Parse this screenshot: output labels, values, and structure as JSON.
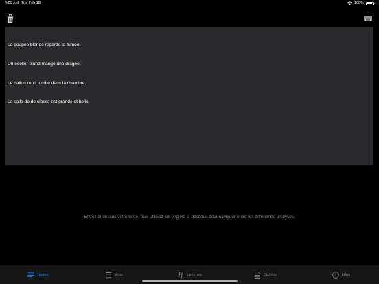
{
  "status_bar": {
    "time": "4:00 AM",
    "date": "Tue Feb 18",
    "battery": "100%"
  },
  "editor": {
    "lines": [
      "La poupée blonde regarde la fumée.",
      "Un écolier blond mange une dragée.",
      "Le ballon rond tombe dans la chambre.",
      "La salle de de classe est grande et belle."
    ]
  },
  "instruction": "Entrez ci-dessus votre texte, puis utilisez les onglets ci-dessous pour naviguer entre les différentes analyses.",
  "tabs": [
    {
      "label": "Textes",
      "icon": "text-lines-icon",
      "active": true
    },
    {
      "label": "Mots",
      "icon": "list-icon",
      "active": false
    },
    {
      "label": "Lemmes",
      "icon": "hash-icon",
      "active": false
    },
    {
      "label": "Dictées",
      "icon": "dictation-icon",
      "active": false
    },
    {
      "label": "Infos",
      "icon": "info-icon",
      "active": false
    }
  ],
  "colors": {
    "accent": "#0a84ff",
    "background": "#000000",
    "text_area": "#2a2a2c",
    "tab_bar": "#161616",
    "muted": "#8e8e93"
  }
}
